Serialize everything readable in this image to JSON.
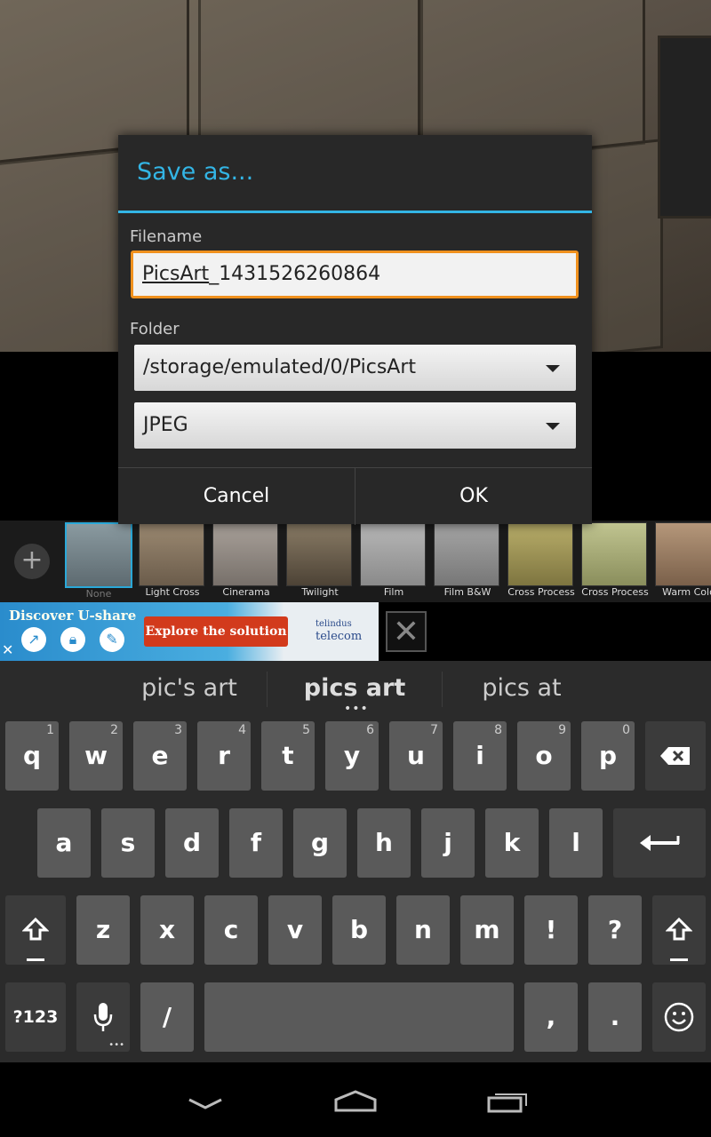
{
  "dialog": {
    "title": "Save as...",
    "filename_label": "Filename",
    "filename_value_prefix": "PicsArt",
    "filename_value_suffix": "_1431526260864",
    "folder_label": "Folder",
    "folder_value": "/storage/emulated/0/PicsArt",
    "format_value": "JPEG",
    "cancel_label": "Cancel",
    "ok_label": "OK"
  },
  "filters": [
    {
      "label": "None",
      "selected": true
    },
    {
      "label": "Light Cross"
    },
    {
      "label": "Cinerama"
    },
    {
      "label": "Twilight"
    },
    {
      "label": "Film"
    },
    {
      "label": "Film B&W"
    },
    {
      "label": "Cross Process"
    },
    {
      "label": "Cross Process"
    },
    {
      "label": "Warm Colo"
    }
  ],
  "ad": {
    "title": "Discover U-share",
    "cta": "Explore the solution",
    "brand_line1": "telindus",
    "brand_line2": "telecom"
  },
  "keyboard": {
    "suggestions": [
      "pic's art",
      "pics art",
      "pics at"
    ],
    "row1": [
      [
        "q",
        "1"
      ],
      [
        "w",
        "2"
      ],
      [
        "e",
        "3"
      ],
      [
        "r",
        "4"
      ],
      [
        "t",
        "5"
      ],
      [
        "y",
        "6"
      ],
      [
        "u",
        "7"
      ],
      [
        "i",
        "8"
      ],
      [
        "o",
        "9"
      ],
      [
        "p",
        "0"
      ]
    ],
    "row2": [
      "a",
      "s",
      "d",
      "f",
      "g",
      "h",
      "j",
      "k",
      "l"
    ],
    "row3": [
      "z",
      "x",
      "c",
      "v",
      "b",
      "n",
      "m",
      "!",
      "?"
    ],
    "symbols_label": "?123",
    "slash": "/",
    "comma": ",",
    "period": "."
  }
}
